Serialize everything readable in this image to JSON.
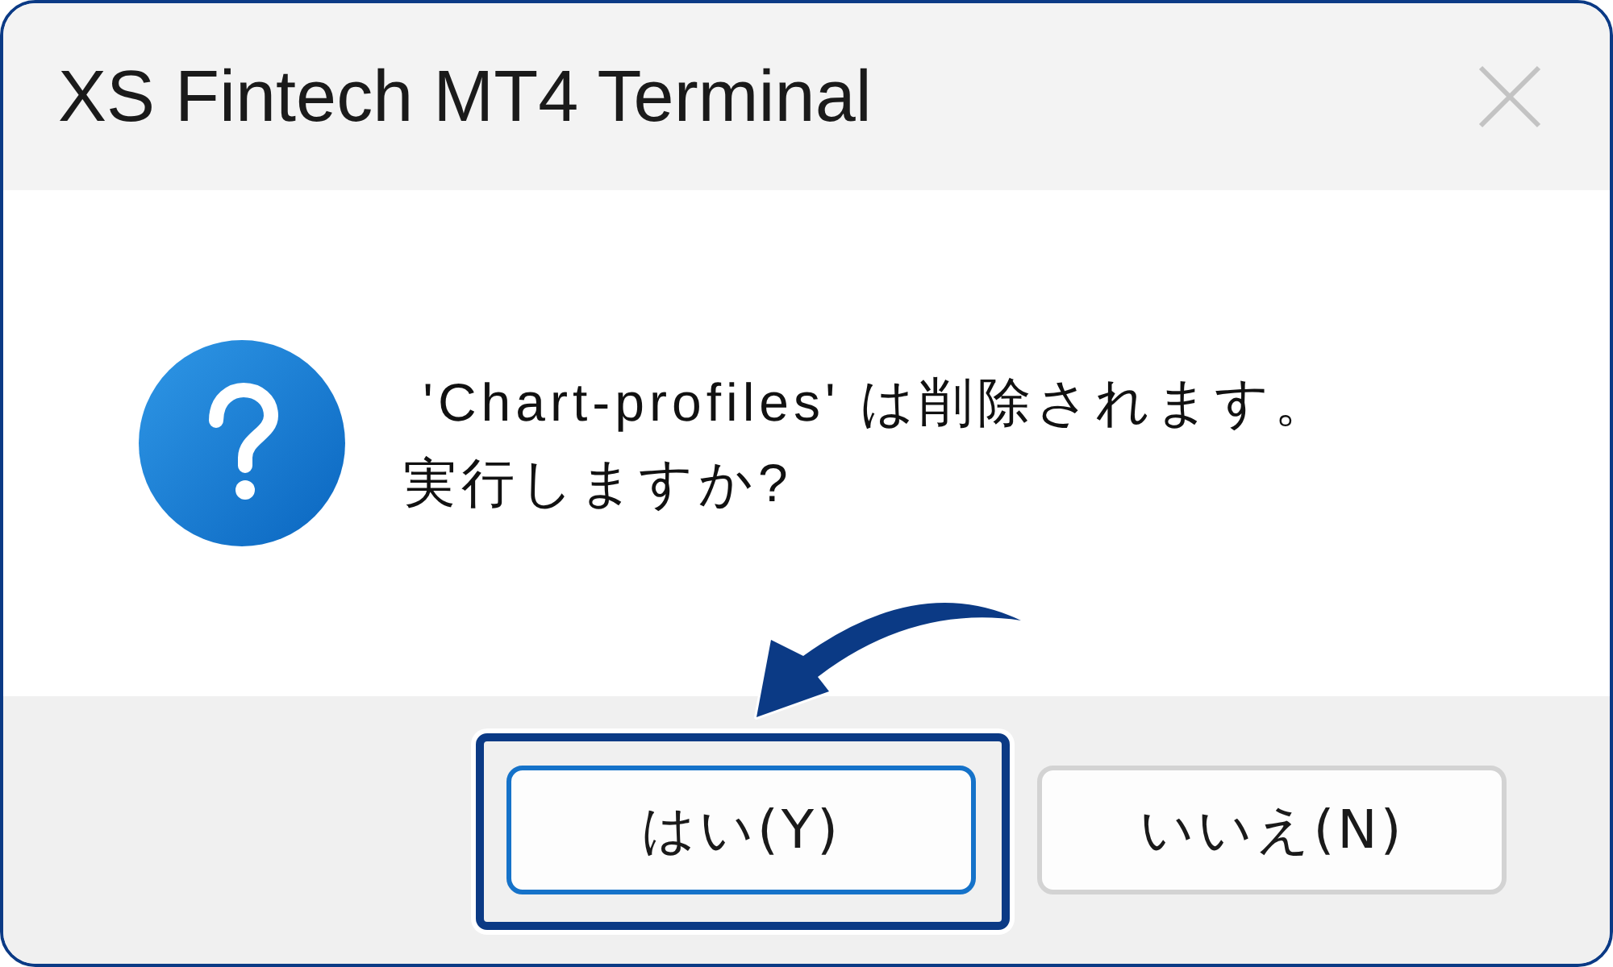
{
  "window": {
    "title": "XS Fintech MT4 Terminal"
  },
  "message": {
    "lines": [
      " 'Chart-profiles' は削除されます。",
      "実行しますか?"
    ]
  },
  "buttons": [
    {
      "label": "はい(Y)",
      "default": true,
      "highlighted": true
    },
    {
      "label": "いいえ(N)",
      "default": false,
      "highlighted": false
    }
  ]
}
